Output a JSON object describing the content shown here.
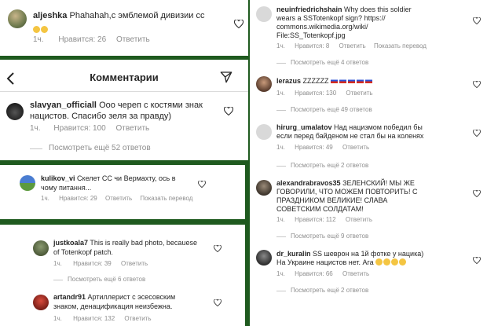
{
  "p1": {
    "user": "aljeshka",
    "text": "Phahahah,с эмблемой дивизии сс",
    "time": "1ч.",
    "likes": "Нравится: 26",
    "reply": "Ответить"
  },
  "p2": {
    "header": "Комментарии",
    "user": "slavyan_officiall",
    "text1": "Ооо череп с костями знак",
    "text2": "нацистов. Спасибо зеля за правду)",
    "time": "1ч.",
    "likes": "Нравится: 100",
    "reply": "Ответить",
    "more": "Посмотреть ещё 52 ответов"
  },
  "p3": {
    "user": "kulikov_vi",
    "text1": "Скелет СС чи Вермахту, ось в",
    "text2": "чому питання...",
    "time": "1ч.",
    "likes": "Нравится: 29",
    "reply": "Ответить",
    "translate": "Показать перевод"
  },
  "p4": {
    "c1": {
      "user": "justkoala7",
      "text1": "This is really bad photo, becauese",
      "text2": "of Totenkopf patch.",
      "time": "1ч.",
      "likes": "Нравится: 39",
      "reply": "Ответить",
      "more": "Посмотреть ещё 6 ответов"
    },
    "c2": {
      "user": "artandr91",
      "text1": "Артиллерист с эсесовским",
      "text2": "знаком, денацификация неизбежна.",
      "time": "1ч.",
      "likes": "Нравится: 132",
      "reply": "Ответить"
    }
  },
  "right": {
    "c1": {
      "user": "neuinfriedrichshain",
      "text1": "Why does this soldier",
      "text2": "wears a SSTotenkopf sign? https://",
      "text3": "commons.wikimedia.org/wiki/",
      "text4": "File:SS_Totenkopf.jpg",
      "time": "1ч.",
      "likes": "Нравится: 8",
      "reply": "Ответить",
      "translate": "Показать перевод",
      "more": "Посмотреть ещё 4 ответов"
    },
    "c2": {
      "user": "lerazus",
      "text": "ZZZZZZ",
      "time": "1ч.",
      "likes": "Нравится: 130",
      "reply": "Ответить",
      "more": "Посмотреть ещё 49 ответов"
    },
    "c3": {
      "user": "hirurg_umalatov",
      "text1": "Над нацизмом победил бы",
      "text2": "если перед байденом не стал бы на коленях",
      "time": "1ч.",
      "likes": "Нравится: 49",
      "reply": "Ответить",
      "more": "Посмотреть ещё 2 ответов"
    },
    "c4": {
      "user": "alexandrabravos35",
      "text1": "ЗЕЛЕНСКИЙ! МЫ ЖЕ",
      "text2": "ГОВОРИЛИ, ЧТО МОЖЕМ ПОВТОРИТЬ! С",
      "text3": "ПРАЗДНИКОМ ВЕЛИКИЕ! СЛАВА",
      "text4": "СОВЕТСКИМ СОЛДАТАМ!",
      "time": "1ч.",
      "likes": "Нравится: 112",
      "reply": "Ответить",
      "more": "Посмотреть ещё 9 ответов"
    },
    "c5": {
      "user": "dr_kuralin",
      "text1": "SS шеврон на 1й фотке у нацика)",
      "text2": "На Украине нацистов нет.  Ага",
      "time": "1ч.",
      "likes": "Нравится: 66",
      "reply": "Ответить",
      "more": "Посмотреть ещё 2 ответов"
    }
  },
  "colors": {
    "frame": "#1f5a1f",
    "meta": "#8e8e8e",
    "text": "#262626"
  },
  "icons": [
    "heart-icon",
    "back-arrow-icon",
    "send-icon",
    "laughing-emoji-icon",
    "russian-flag-icon"
  ]
}
